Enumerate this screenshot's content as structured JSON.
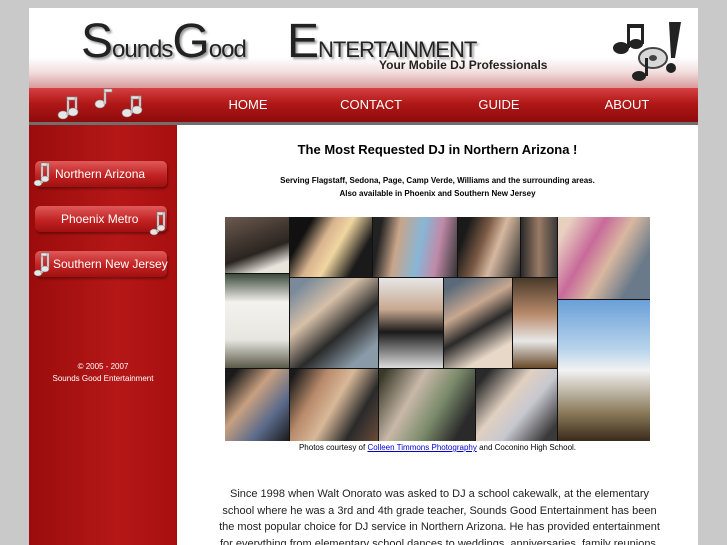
{
  "header": {
    "logo": {
      "s_cap": "S",
      "s_rest": "ounds",
      "g_cap": "G",
      "g_rest": "ood",
      "e_cap": "E",
      "e_rest": "NTERTAINMENT"
    },
    "tagline": "Your Mobile DJ Professionals",
    "logo_icon": "music-notes-exclamation-icon"
  },
  "nav": {
    "items": [
      "HOME",
      "CONTACT",
      "GUIDE",
      "ABOUT"
    ],
    "decor_icon": "music-notes-icon"
  },
  "sidebar": {
    "buttons": [
      "Northern  Arizona",
      "Phoenix  Metro",
      "Southern  New  Jersey"
    ],
    "button_icon": "music-note-icon",
    "copyright_line1": "© 2005 - 2007",
    "copyright_line2": "Sounds Good Entertainment"
  },
  "main": {
    "headline": "The Most Requested DJ in Northern Arizona !",
    "serving_line1": "Serving Flagstaff, Sedona, Page, Camp Verde, Williams and the surrounding areas.",
    "serving_line2": "Also available in Phoenix and Southern New Jersey",
    "credit_prefix": "Photos courtesy of ",
    "credit_link": "Colleen Timmons Photography",
    "credit_suffix": " and Coconino High School.",
    "body": "Since 1998 when Walt Onorato was asked to DJ a school cakewalk, at the elementary school where he was a 3rd and 4th grade teacher, Sounds Good Entertainment has been the most popular choice for DJ service in Northern Arizona. He has provided entertainment for everything from elementary school dances to weddings, anniversaries, family reunions,"
  },
  "colors": {
    "brand_red": "#b11818",
    "dark_red": "#8e0a0a",
    "page_bg": "#c9c9c9",
    "link_blue": "#0000cc"
  }
}
